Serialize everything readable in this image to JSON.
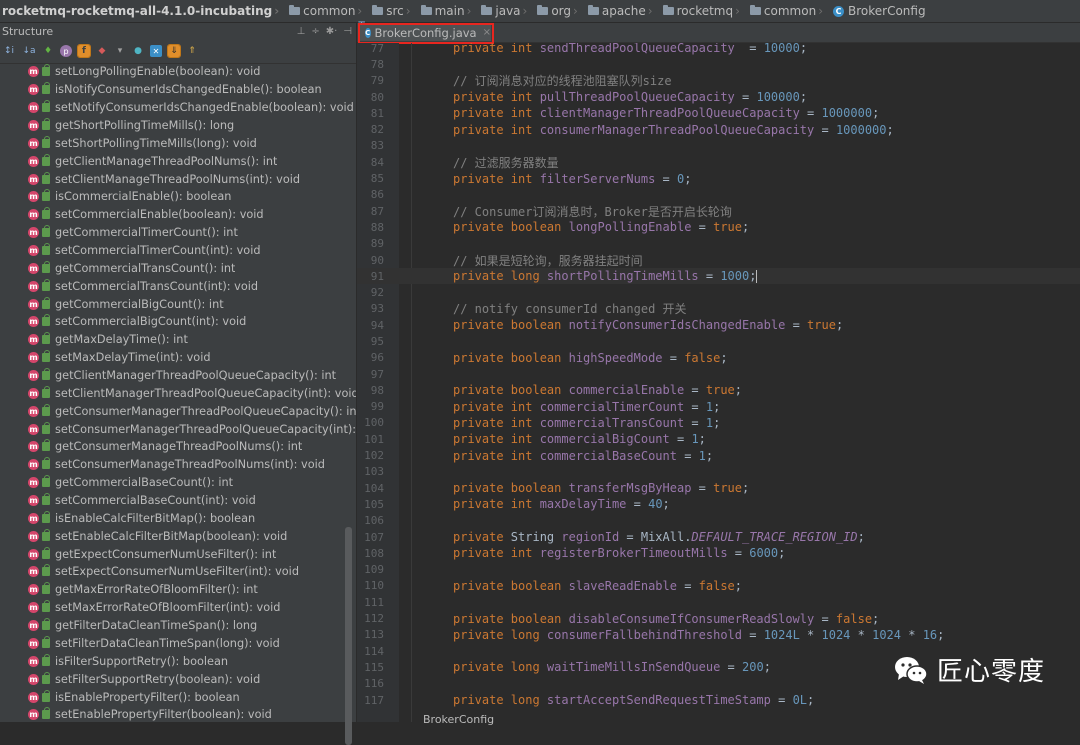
{
  "breadcrumb": [
    {
      "label": "rocketmq-rocketmq-all-4.1.0-incubating",
      "icon": "none"
    },
    {
      "label": "common",
      "icon": "folder-icon"
    },
    {
      "label": "src",
      "icon": "folder-icon"
    },
    {
      "label": "main",
      "icon": "folder-icon"
    },
    {
      "label": "java",
      "icon": "folder-icon"
    },
    {
      "label": "org",
      "icon": "folder-icon"
    },
    {
      "label": "apache",
      "icon": "folder-icon"
    },
    {
      "label": "rocketmq",
      "icon": "folder-icon"
    },
    {
      "label": "common",
      "icon": "folder-icon"
    },
    {
      "label": "BrokerConfig",
      "icon": "class-icon"
    }
  ],
  "structure": {
    "title": "Structure",
    "methods": [
      "setLongPollingEnable(boolean): void",
      "isNotifyConsumerIdsChangedEnable(): boolean",
      "setNotifyConsumerIdsChangedEnable(boolean): void",
      "getShortPollingTimeMills(): long",
      "setShortPollingTimeMills(long): void",
      "getClientManageThreadPoolNums(): int",
      "setClientManageThreadPoolNums(int): void",
      "isCommercialEnable(): boolean",
      "setCommercialEnable(boolean): void",
      "getCommercialTimerCount(): int",
      "setCommercialTimerCount(int): void",
      "getCommercialTransCount(): int",
      "setCommercialTransCount(int): void",
      "getCommercialBigCount(): int",
      "setCommercialBigCount(int): void",
      "getMaxDelayTime(): int",
      "setMaxDelayTime(int): void",
      "getClientManagerThreadPoolQueueCapacity(): int",
      "setClientManagerThreadPoolQueueCapacity(int): void",
      "getConsumerManagerThreadPoolQueueCapacity(): int",
      "setConsumerManagerThreadPoolQueueCapacity(int): void",
      "getConsumerManageThreadPoolNums(): int",
      "setConsumerManageThreadPoolNums(int): void",
      "getCommercialBaseCount(): int",
      "setCommercialBaseCount(int): void",
      "isEnableCalcFilterBitMap(): boolean",
      "setEnableCalcFilterBitMap(boolean): void",
      "getExpectConsumerNumUseFilter(): int",
      "setExpectConsumerNumUseFilter(int): void",
      "getMaxErrorRateOfBloomFilter(): int",
      "setMaxErrorRateOfBloomFilter(int): void",
      "getFilterDataCleanTimeSpan(): long",
      "setFilterDataCleanTimeSpan(long): void",
      "isFilterSupportRetry(): boolean",
      "setFilterSupportRetry(boolean): void",
      "isEnablePropertyFilter(): boolean",
      "setEnablePropertyFilter(boolean): void"
    ]
  },
  "editor": {
    "tab_label": "BrokerConfig.java",
    "status_crumb": "BrokerConfig",
    "current_line": 91,
    "lines": [
      {
        "n": "77",
        "t": [
          [
            "kw",
            "private "
          ],
          [
            "kw",
            "int "
          ],
          [
            "fld",
            "sendThreadPoolQueueCapacity"
          ],
          [
            "",
            "  = "
          ],
          [
            "num",
            "10000"
          ],
          [
            "",
            ";"
          ]
        ]
      },
      {
        "n": "78",
        "t": []
      },
      {
        "n": "79",
        "t": [
          [
            "cmt",
            "// 订阅消息对应的线程池阻塞队列size"
          ]
        ]
      },
      {
        "n": "80",
        "t": [
          [
            "kw",
            "private "
          ],
          [
            "kw",
            "int "
          ],
          [
            "fld",
            "pullThreadPoolQueueCapacity"
          ],
          [
            "",
            " = "
          ],
          [
            "num",
            "100000"
          ],
          [
            "",
            ";"
          ]
        ]
      },
      {
        "n": "81",
        "t": [
          [
            "kw",
            "private "
          ],
          [
            "kw",
            "int "
          ],
          [
            "fld",
            "clientManagerThreadPoolQueueCapacity"
          ],
          [
            "",
            " = "
          ],
          [
            "num",
            "1000000"
          ],
          [
            "",
            ";"
          ]
        ]
      },
      {
        "n": "82",
        "t": [
          [
            "kw",
            "private "
          ],
          [
            "kw",
            "int "
          ],
          [
            "fld",
            "consumerManagerThreadPoolQueueCapacity"
          ],
          [
            "",
            " = "
          ],
          [
            "num",
            "1000000"
          ],
          [
            "",
            ";"
          ]
        ]
      },
      {
        "n": "83",
        "t": []
      },
      {
        "n": "84",
        "t": [
          [
            "cmt",
            "// 过滤服务器数量"
          ]
        ]
      },
      {
        "n": "85",
        "t": [
          [
            "kw",
            "private "
          ],
          [
            "kw",
            "int "
          ],
          [
            "fld",
            "filterServerNums"
          ],
          [
            "",
            " = "
          ],
          [
            "num",
            "0"
          ],
          [
            "",
            ";"
          ]
        ]
      },
      {
        "n": "86",
        "t": []
      },
      {
        "n": "87",
        "t": [
          [
            "cmt",
            "// Consumer订阅消息时，Broker是否开启长轮询"
          ]
        ]
      },
      {
        "n": "88",
        "t": [
          [
            "kw",
            "private "
          ],
          [
            "kw",
            "boolean "
          ],
          [
            "fld",
            "longPollingEnable"
          ],
          [
            "",
            " = "
          ],
          [
            "kw",
            "true"
          ],
          [
            "",
            ";"
          ]
        ]
      },
      {
        "n": "89",
        "t": []
      },
      {
        "n": "90",
        "t": [
          [
            "cmt",
            "// 如果是短轮询，服务器挂起时间"
          ]
        ]
      },
      {
        "n": "91",
        "t": [
          [
            "kw",
            "private "
          ],
          [
            "kw",
            "long "
          ],
          [
            "fld",
            "shortPollingTimeMills"
          ],
          [
            "",
            " = "
          ],
          [
            "num",
            "1000"
          ],
          [
            "",
            ";"
          ]
        ]
      },
      {
        "n": "92",
        "t": []
      },
      {
        "n": "93",
        "t": [
          [
            "cmt",
            "// notify consumerId changed 开关"
          ]
        ]
      },
      {
        "n": "94",
        "t": [
          [
            "kw",
            "private "
          ],
          [
            "kw",
            "boolean "
          ],
          [
            "fld",
            "notifyConsumerIdsChangedEnable"
          ],
          [
            "",
            " = "
          ],
          [
            "kw",
            "true"
          ],
          [
            "",
            ";"
          ]
        ]
      },
      {
        "n": "95",
        "t": []
      },
      {
        "n": "96",
        "t": [
          [
            "kw",
            "private "
          ],
          [
            "kw",
            "boolean "
          ],
          [
            "fld",
            "highSpeedMode"
          ],
          [
            "",
            " = "
          ],
          [
            "kw",
            "false"
          ],
          [
            "",
            ";"
          ]
        ]
      },
      {
        "n": "97",
        "t": []
      },
      {
        "n": "98",
        "t": [
          [
            "kw",
            "private "
          ],
          [
            "kw",
            "boolean "
          ],
          [
            "fld",
            "commercialEnable"
          ],
          [
            "",
            " = "
          ],
          [
            "kw",
            "true"
          ],
          [
            "",
            ";"
          ]
        ]
      },
      {
        "n": "99",
        "t": [
          [
            "kw",
            "private "
          ],
          [
            "kw",
            "int "
          ],
          [
            "fld",
            "commercialTimerCount"
          ],
          [
            "",
            " = "
          ],
          [
            "num",
            "1"
          ],
          [
            "",
            ";"
          ]
        ]
      },
      {
        "n": "100",
        "t": [
          [
            "kw",
            "private "
          ],
          [
            "kw",
            "int "
          ],
          [
            "fld",
            "commercialTransCount"
          ],
          [
            "",
            " = "
          ],
          [
            "num",
            "1"
          ],
          [
            "",
            ";"
          ]
        ]
      },
      {
        "n": "101",
        "t": [
          [
            "kw",
            "private "
          ],
          [
            "kw",
            "int "
          ],
          [
            "fld",
            "commercialBigCount"
          ],
          [
            "",
            " = "
          ],
          [
            "num",
            "1"
          ],
          [
            "",
            ";"
          ]
        ]
      },
      {
        "n": "102",
        "t": [
          [
            "kw",
            "private "
          ],
          [
            "kw",
            "int "
          ],
          [
            "fld",
            "commercialBaseCount"
          ],
          [
            "",
            " = "
          ],
          [
            "num",
            "1"
          ],
          [
            "",
            ";"
          ]
        ]
      },
      {
        "n": "103",
        "t": []
      },
      {
        "n": "104",
        "t": [
          [
            "kw",
            "private "
          ],
          [
            "kw",
            "boolean "
          ],
          [
            "fld",
            "transferMsgByHeap"
          ],
          [
            "",
            " = "
          ],
          [
            "kw",
            "true"
          ],
          [
            "",
            ";"
          ]
        ]
      },
      {
        "n": "105",
        "t": [
          [
            "kw",
            "private "
          ],
          [
            "kw",
            "int "
          ],
          [
            "fld",
            "maxDelayTime"
          ],
          [
            "",
            " = "
          ],
          [
            "num",
            "40"
          ],
          [
            "",
            ";"
          ]
        ]
      },
      {
        "n": "106",
        "t": []
      },
      {
        "n": "107",
        "t": [
          [
            "kw",
            "private "
          ],
          [
            "",
            "String "
          ],
          [
            "fld",
            "regionId"
          ],
          [
            "",
            " = MixAll."
          ],
          [
            "ital",
            "DEFAULT_TRACE_REGION_ID"
          ],
          [
            "",
            ";"
          ]
        ]
      },
      {
        "n": "108",
        "t": [
          [
            "kw",
            "private "
          ],
          [
            "kw",
            "int "
          ],
          [
            "fld",
            "registerBrokerTimeoutMills"
          ],
          [
            "",
            " = "
          ],
          [
            "num",
            "6000"
          ],
          [
            "",
            ";"
          ]
        ]
      },
      {
        "n": "109",
        "t": []
      },
      {
        "n": "110",
        "t": [
          [
            "kw",
            "private "
          ],
          [
            "kw",
            "boolean "
          ],
          [
            "fld",
            "slaveReadEnable"
          ],
          [
            "",
            " = "
          ],
          [
            "kw",
            "false"
          ],
          [
            "",
            ";"
          ]
        ]
      },
      {
        "n": "111",
        "t": []
      },
      {
        "n": "112",
        "t": [
          [
            "kw",
            "private "
          ],
          [
            "kw",
            "boolean "
          ],
          [
            "fld",
            "disableConsumeIfConsumerReadSlowly"
          ],
          [
            "",
            " = "
          ],
          [
            "kw",
            "false"
          ],
          [
            "",
            ";"
          ]
        ]
      },
      {
        "n": "113",
        "t": [
          [
            "kw",
            "private "
          ],
          [
            "kw",
            "long "
          ],
          [
            "fld",
            "consumerFallbehindThreshold"
          ],
          [
            "",
            " = "
          ],
          [
            "num",
            "1024L"
          ],
          [
            "",
            " * "
          ],
          [
            "num",
            "1024"
          ],
          [
            "",
            " * "
          ],
          [
            "num",
            "1024"
          ],
          [
            "",
            " * "
          ],
          [
            "num",
            "16"
          ],
          [
            "",
            ";"
          ]
        ]
      },
      {
        "n": "114",
        "t": []
      },
      {
        "n": "115",
        "t": [
          [
            "kw",
            "private "
          ],
          [
            "kw",
            "long "
          ],
          [
            "fld",
            "waitTimeMillsInSendQueue"
          ],
          [
            "",
            " = "
          ],
          [
            "num",
            "200"
          ],
          [
            "",
            ";"
          ]
        ]
      },
      {
        "n": "116",
        "t": []
      },
      {
        "n": "117",
        "t": [
          [
            "kw",
            "private "
          ],
          [
            "kw",
            "long "
          ],
          [
            "fld",
            "startAcceptSendRequestTimeStamp"
          ],
          [
            "",
            " = "
          ],
          [
            "num",
            "0L"
          ],
          [
            "",
            ";"
          ]
        ]
      }
    ]
  },
  "watermark": {
    "text": "匠心零度",
    "icon": "wechat-icon"
  }
}
